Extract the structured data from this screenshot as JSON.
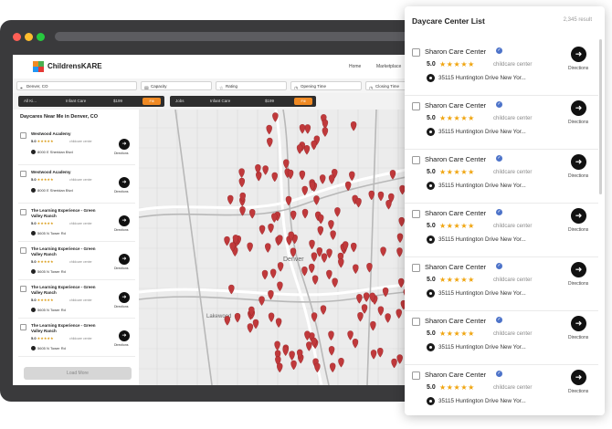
{
  "website": {
    "brand": "ChildrensKARE",
    "nav": [
      "Home",
      "Marketplace"
    ],
    "filters": {
      "location": "Denver, CO",
      "capacity": "Capacity",
      "rating": "Rating",
      "opening_time": "Opening Time",
      "closing_time": "Closing Time"
    },
    "bar1": {
      "left": "All Ki...",
      "mid": "Infant Care",
      "price": "$199",
      "button": "Fill"
    },
    "bar2": {
      "left": "Jobs",
      "mid": "Infant Care",
      "price": "$199",
      "button": "Fill"
    },
    "panel_title": "Daycares Near Me in Denver, CO",
    "items": [
      {
        "name": "Westwood Academy",
        "score": "5.0",
        "type": "childcare center",
        "address": "8000 E Sheridan Blvd",
        "directions": "Directions"
      },
      {
        "name": "Westwood Academy",
        "score": "5.0",
        "type": "childcare center",
        "address": "8000 E Sheridan Blvd",
        "directions": "Directions"
      },
      {
        "name": "The Learning Experience - Green Valley Ranch",
        "score": "5.0",
        "type": "childcare center",
        "address": "5605 N Tower Rd",
        "directions": "Directions"
      },
      {
        "name": "The Learning Experience - Green Valley Ranch",
        "score": "5.0",
        "type": "childcare center",
        "address": "5605 N Tower Rd",
        "directions": "Directions"
      },
      {
        "name": "The Learning Experience - Green Valley Ranch",
        "score": "5.0",
        "type": "childcare center",
        "address": "5605 N Tower Rd",
        "directions": "Directions"
      },
      {
        "name": "The Learning Experience - Green Valley Ranch",
        "score": "5.0",
        "type": "childcare center",
        "address": "5605 N Tower Rd",
        "directions": "Directions"
      }
    ],
    "load_more": "Load More"
  },
  "list": {
    "title": "Daycare Center List",
    "count": "2,345 result",
    "items": [
      {
        "name": "Sharon Care Center",
        "score": "5.0",
        "stars": "★★★★★",
        "type": "childcare center",
        "address": "35115 Huntington Drive New Yor...",
        "directions": "Directions"
      },
      {
        "name": "Sharon Care Center",
        "score": "5.0",
        "stars": "★★★★★",
        "type": "childcare center",
        "address": "35115 Huntington Drive New Yor...",
        "directions": "Directions"
      },
      {
        "name": "Sharon Care Center",
        "score": "5.0",
        "stars": "★★★★★",
        "type": "childcare center",
        "address": "35115 Huntington Drive New Yor...",
        "directions": "Directions"
      },
      {
        "name": "Sharon Care Center",
        "score": "5.0",
        "stars": "★★★★★",
        "type": "childcare center",
        "address": "35115 Huntington Drive New Yor...",
        "directions": "Directions"
      },
      {
        "name": "Sharon Care Center",
        "score": "5.0",
        "stars": "★★★★★",
        "type": "childcare center",
        "address": "35115 Huntington Drive New Yor...",
        "directions": "Directions"
      },
      {
        "name": "Sharon Care Center",
        "score": "5.0",
        "stars": "★★★★★",
        "type": "childcare center",
        "address": "35115 Huntington Drive New Yor...",
        "directions": "Directions"
      },
      {
        "name": "Sharon Care Center",
        "score": "5.0",
        "stars": "★★★★★",
        "type": "childcare center",
        "address": "35115 Huntington Drive New Yor...",
        "directions": "Directions"
      }
    ]
  },
  "map": {
    "place_labels": [
      "Denver",
      "Lakewood"
    ],
    "pin_count": 160
  },
  "colors": {
    "accent_orange": "#f08a24",
    "pin_red": "#c0393b",
    "star_gold": "#f0a510",
    "verified_blue": "#4d73c9"
  },
  "icons": {
    "verified": "verified-check-icon",
    "directions": "directions-arrow-icon",
    "location": "map-pin-icon",
    "search": "search-icon"
  }
}
